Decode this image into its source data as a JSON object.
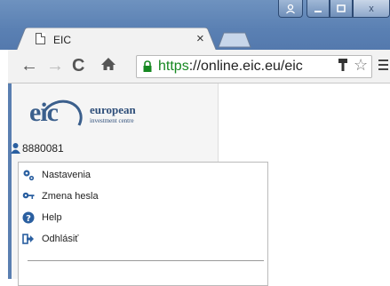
{
  "browser": {
    "tab_title": "EIC",
    "tab_close": "×",
    "url_scheme": "https",
    "url_rest": "://online.eic.eu/eic",
    "window_buttons": {
      "user": "user-icon",
      "minimize": "_",
      "maximize": "□",
      "close": "x"
    },
    "icons": {
      "back": "←",
      "forward": "→",
      "reload": "C",
      "home": "🏠",
      "key": "🔑",
      "star": "☆"
    }
  },
  "sidebar": {
    "logo": {
      "mark": "eic",
      "brand": "european",
      "sub": "investment centre"
    },
    "user_id": "8880081"
  },
  "dropdown": {
    "items": [
      {
        "label": "Nastavenia",
        "icon": "gears-icon"
      },
      {
        "label": "Zmena hesla",
        "icon": "key-icon"
      },
      {
        "label": "Help",
        "icon": "help-icon"
      },
      {
        "label": "Odhlásiť",
        "icon": "logout-icon"
      }
    ]
  },
  "colors": {
    "accent": "#2a5fa0",
    "titlebar": "#5a80b3",
    "https_green": "#168821"
  }
}
